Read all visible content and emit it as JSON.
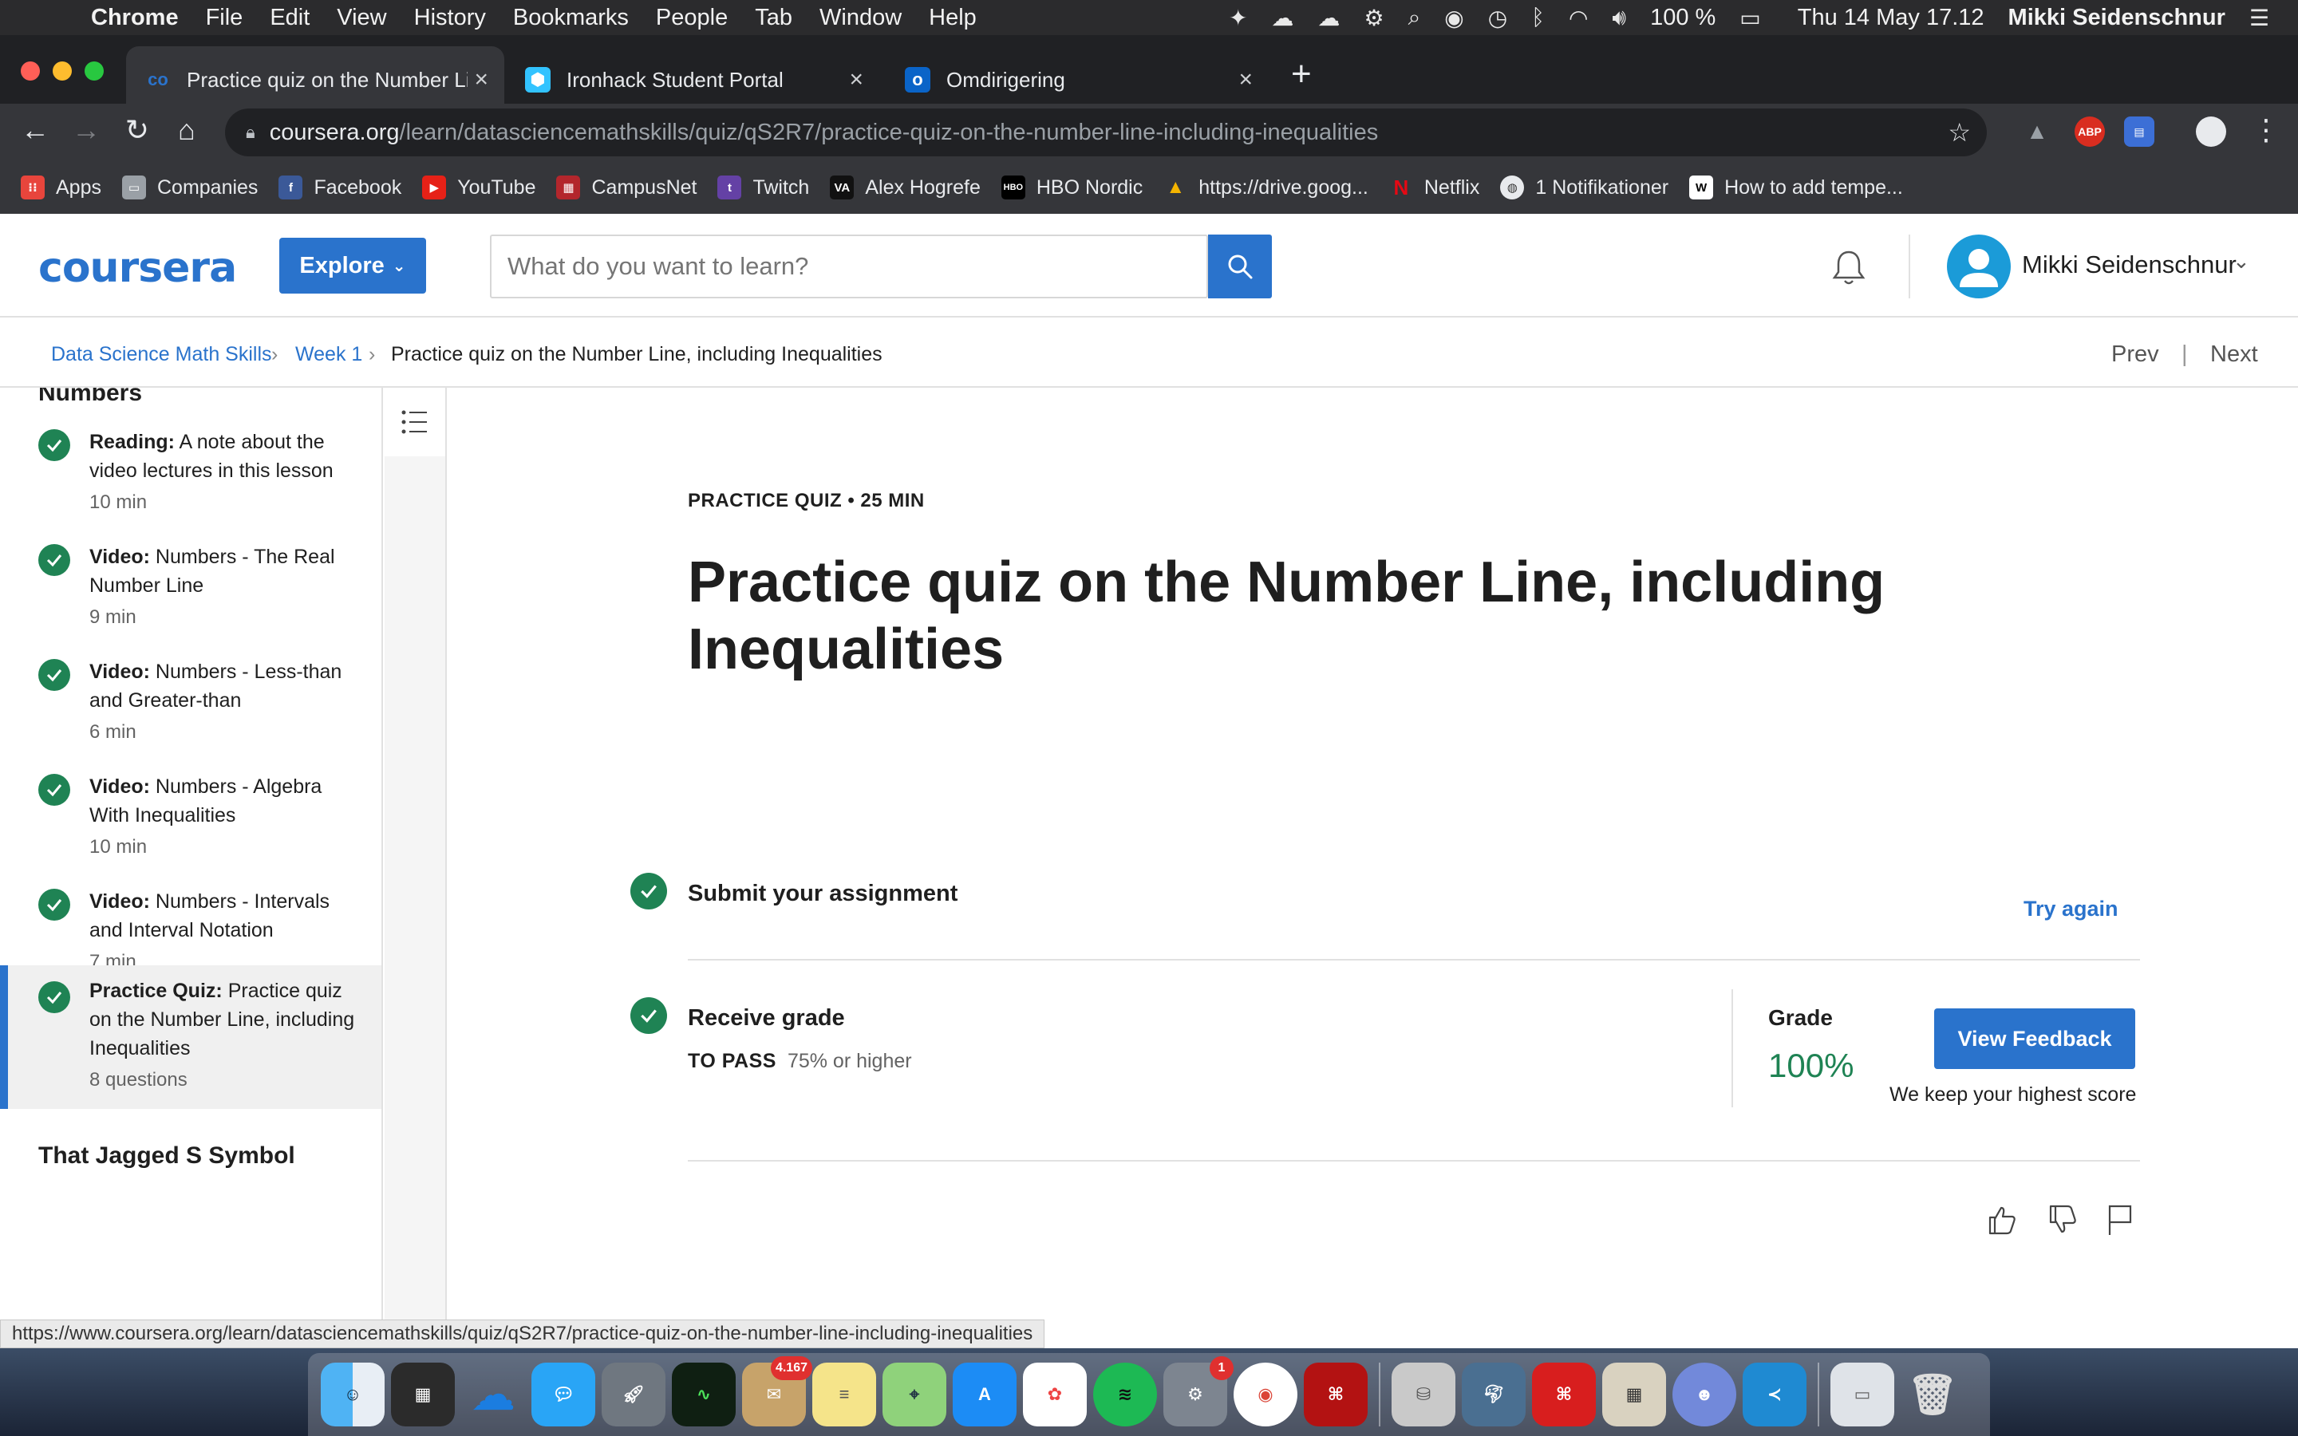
{
  "menubar": {
    "app": "Chrome",
    "items": [
      "File",
      "Edit",
      "View",
      "History",
      "Bookmarks",
      "People",
      "Tab",
      "Window",
      "Help"
    ],
    "battery": "100 %",
    "clock": "Thu 14 May  17.12",
    "user": "Mikki Seidenschnur"
  },
  "tabs": [
    {
      "title": "Practice quiz on the Number Li",
      "favicon": "coursera-icon",
      "active": true
    },
    {
      "title": "Ironhack Student Portal",
      "favicon": "ironhack-icon",
      "active": false
    },
    {
      "title": "Omdirigering",
      "favicon": "outlook-icon",
      "active": false
    }
  ],
  "address": {
    "host": "coursera.org",
    "path": "/learn/datasciencemathskills/quiz/qS2R7/practice-quiz-on-the-number-line-including-inequalities"
  },
  "bookmarks": [
    {
      "label": "Apps",
      "icon": "apps-grid-icon",
      "color": "#e8453c"
    },
    {
      "label": "Companies",
      "icon": "folder-icon",
      "color": "#9aa0a6"
    },
    {
      "label": "Facebook",
      "icon": "facebook-icon",
      "color": "#3b5998"
    },
    {
      "label": "YouTube",
      "icon": "youtube-icon",
      "color": "#e62117"
    },
    {
      "label": "CampusNet",
      "icon": "campusnet-icon",
      "color": "#b3262c"
    },
    {
      "label": "Twitch",
      "icon": "twitch-icon",
      "color": "#6441a5"
    },
    {
      "label": "Alex Hogrefe",
      "icon": "va-icon",
      "color": "#111111"
    },
    {
      "label": "HBO Nordic",
      "icon": "hbo-icon",
      "color": "#000000"
    },
    {
      "label": "https://drive.goog...",
      "icon": "drive-icon",
      "color": "#f4b400"
    },
    {
      "label": "Netflix",
      "icon": "netflix-icon",
      "color": "#e50914"
    },
    {
      "label": "1 Notifikationer",
      "icon": "globe-icon",
      "color": "#5f6368"
    },
    {
      "label": "How to add tempe...",
      "icon": "wikipedia-icon",
      "color": "#ffffff"
    }
  ],
  "header": {
    "logo": "coursera",
    "explore": "Explore",
    "search_placeholder": "What do you want to learn?",
    "user_name": "Mikki Seidenschnur"
  },
  "breadcrumb": {
    "course": "Data Science Math Skills",
    "week": "Week 1",
    "current": "Practice quiz on the Number Line, including Inequalities",
    "prev": "Prev",
    "next": "Next"
  },
  "sidebar": {
    "section_top": "Numbers",
    "items": [
      {
        "type": "Reading:",
        "title": "A note about the video lectures in this lesson",
        "meta": "10 min"
      },
      {
        "type": "Video:",
        "title": "Numbers - The Real Number Line",
        "meta": "9 min"
      },
      {
        "type": "Video:",
        "title": "Numbers - Less-than and Greater-than",
        "meta": "6 min"
      },
      {
        "type": "Video:",
        "title": "Numbers - Algebra With Inequalities",
        "meta": "10 min"
      },
      {
        "type": "Video:",
        "title": "Numbers - Intervals and Interval Notation",
        "meta": "7 min"
      },
      {
        "type": "Practice Quiz:",
        "title": "Practice quiz on the Number Line, including Inequalities",
        "meta": "8 questions"
      }
    ],
    "section_bottom": "That Jagged S Symbol"
  },
  "content": {
    "kicker": "PRACTICE QUIZ • 25 MIN",
    "title": "Practice quiz on the Number Line, including Inequalities",
    "submit_title": "Submit your assignment",
    "try_again": "Try again",
    "receive_title": "Receive grade",
    "to_pass_label": "TO PASS",
    "to_pass_value": "75% or higher",
    "grade_label": "Grade",
    "grade_value": "100%",
    "view_feedback": "View Feedback",
    "keep_note": "We keep your highest score"
  },
  "status_url": "https://www.coursera.org/learn/datasciencemathskills/quiz/qS2R7/practice-quiz-on-the-number-line-including-inequalities",
  "dock": {
    "mail_badge": "4.167",
    "prefs_badge": "1"
  },
  "colors": {
    "accent": "#2a73cc",
    "success": "#1f8354"
  }
}
